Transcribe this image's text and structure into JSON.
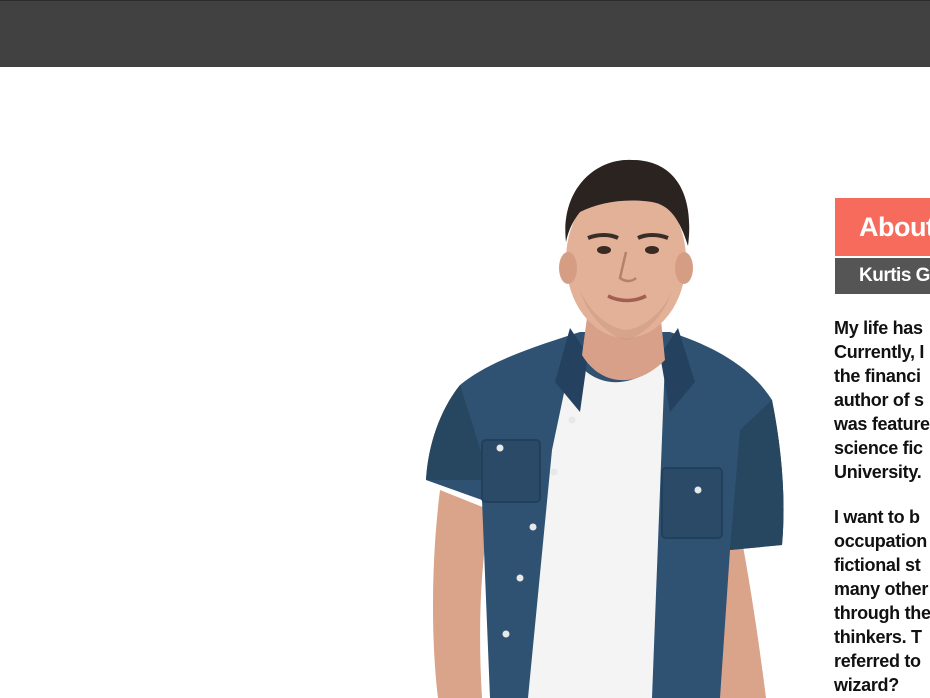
{
  "header": {
    "bar_color": "#414141"
  },
  "portrait": {
    "alt": "Portrait photo of man in blue denim shirt over white t-shirt"
  },
  "about": {
    "title": "About",
    "name": "Kurtis G",
    "title_color": "#f76b5c",
    "name_bar_color": "#555555"
  },
  "bio": {
    "paragraph_1": [
      "My life has",
      "Currently, I",
      "the financi",
      "author of s",
      "was feature",
      "science fic",
      "University."
    ],
    "paragraph_2": [
      "I want to b",
      "occupation",
      "fictional st",
      "many other",
      "through the",
      "thinkers. T",
      "referred to",
      "wizard?"
    ]
  }
}
